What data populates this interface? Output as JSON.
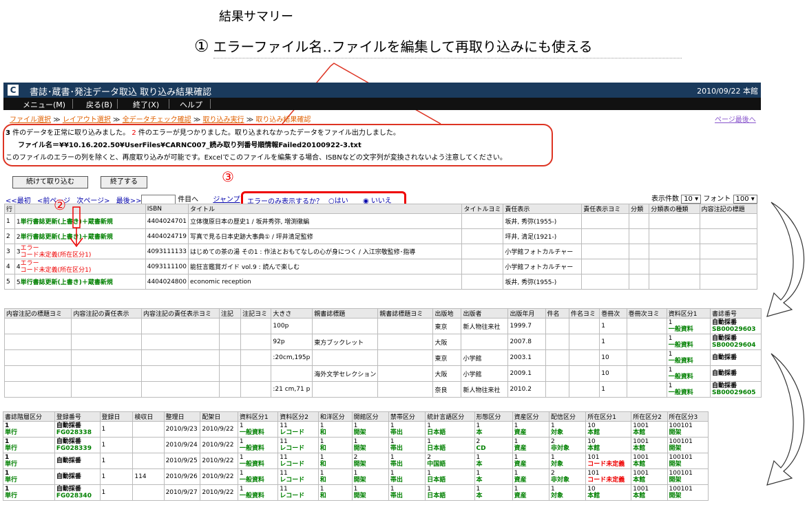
{
  "annotations": {
    "title": "結果サマリー",
    "num1": "①",
    "subtitle": "エラーファイル名‥ファイルを編集して再取り込みにも使える",
    "num2": "②",
    "num3": "③"
  },
  "window": {
    "title": "書誌･蔵書･発注データ取込 取り込み結果確認",
    "date": "2010/09/22 本館",
    "logo": "C"
  },
  "menu": [
    "メニュー(M)",
    "戻る(B)",
    "終了(X)",
    "ヘルプ"
  ],
  "breadcrumbs": [
    "ファイル選択",
    "レイアウト選択",
    "全データチェック確認",
    "取り込み実行",
    "取り込み結果確認"
  ],
  "breadcrumb_sep": "≫",
  "page_last": "ページ最後へ",
  "summary": {
    "ok_count": "3",
    "ok_text": "件のデータを正常に取り込みました。",
    "err_count": "2",
    "err_text": "件のエラーが見つかりました。取り込まれなかったデータをファイル出力しました。",
    "file_label": "ファイル名＝¥¥10.16.202.50¥UserFiles¥CARNC007_読み取り列番号順情報Failed20100922-3.txt",
    "note": "このファイルのエラーの列を除くと、再度取り込みが可能です。Excelでこのファイルを編集する場合、ISBNなどの文字列が変換されないよう注意してください。"
  },
  "buttons": {
    "continue": "続けて取り込む",
    "finish": "終了する"
  },
  "nav": {
    "first": "<<最初",
    "prev": "<前ページ",
    "next": "次ページ>",
    "last": "最後>>",
    "page_value": "",
    "page_suffix": "件目へ",
    "jump": "ジャンプ"
  },
  "filter": {
    "question": "エラーのみ表示するか？",
    "yes": "はい",
    "no": "いいえ",
    "selected": "no"
  },
  "display": {
    "count_label": "表示件数",
    "count_value": "10",
    "font_label": "フォント",
    "font_value": "100"
  },
  "table1": {
    "headers": [
      "行",
      "",
      "ISBN",
      "タイトル",
      "タイトルヨミ",
      "責任表示",
      "責任表示ヨミ",
      "分類",
      "分類表の種類",
      "内容注記の標題"
    ],
    "rows": [
      {
        "row": "1",
        "no": "1",
        "status": "単行書誌更新(上書き)＋蔵書新規",
        "status_type": "ok",
        "isbn": "4404024701",
        "title": "立体復原日本の歴史1 / 坂井秀弥, 増渕徹編",
        "resp": "坂井, 秀弥(1955-)"
      },
      {
        "row": "2",
        "no": "2",
        "status": "単行書誌更新(上書き)＋蔵書新規",
        "status_type": "ok",
        "isbn": "4404024719",
        "title": "写真で見る日本史跡大事典① / 坪井清足監修",
        "resp": "坪井, 清足(1921-)"
      },
      {
        "row": "3",
        "no": "3",
        "status": "エラー",
        "status2": "コード未定義(所在区分1)",
        "status_type": "err",
        "isbn": "4093111133",
        "title": "はじめての茶の湯 その1 : 作法とおもてなしの心が身につく / 入江宗敬監修･指導",
        "resp": "小学館フォトカルチャー"
      },
      {
        "row": "4",
        "no": "4",
        "status": "エラー",
        "status2": "コード未定義(所在区分1)",
        "status_type": "err",
        "isbn": "4093111100",
        "title": "能狂言鑑賞ガイド vol.9 : 読んで楽しむ",
        "resp": "小学館フォトカルチャー"
      },
      {
        "row": "5",
        "no": "5",
        "status": "単行書誌更新(上書き)＋蔵書新規",
        "status_type": "ok",
        "isbn": "4404024800",
        "title": "economic reception",
        "resp": "坂井, 秀弥(1955-)"
      }
    ]
  },
  "table2": {
    "headers": [
      "内容注記の標題ヨミ",
      "内容注記の責任表示",
      "内容注記の責任表示ヨミ",
      "注記",
      "注記ヨミ",
      "大きさ",
      "親書誌標題",
      "親書誌標題ヨミ",
      "出版地",
      "出版者",
      "出版年月",
      "件名",
      "件名ヨミ",
      "巻冊次",
      "巻冊次ヨミ",
      "資料区分1",
      "書誌番号"
    ],
    "rows": [
      {
        "size": "100p",
        "parent": "",
        "place": "東京",
        "pub": "新人物往来社",
        "date": "1999.7",
        "vol": "1",
        "type1a": "1",
        "type1b": "一般資料",
        "bib": "自動採番",
        "bib2": "SB00029603"
      },
      {
        "size": "92p",
        "parent": "東方ブックレット",
        "place": "大阪",
        "pub": "",
        "date": "2007.8",
        "vol": "1",
        "type1a": "1",
        "type1b": "一般資料",
        "bib": "自動採番",
        "bib2": "SB00029604"
      },
      {
        "size": ":20cm,195p",
        "parent": "",
        "place": "東京",
        "pub": "小学館",
        "date": "2003.1",
        "vol": "10",
        "type1a": "1",
        "type1b": "一般資料",
        "bib": "自動採番",
        "bib2": ""
      },
      {
        "size": "",
        "parent": "海外文学セレクション",
        "place": "大阪",
        "pub": "小学館",
        "date": "2009.1",
        "vol": "10",
        "type1a": "1",
        "type1b": "一般資料",
        "bib": "自動採番",
        "bib2": ""
      },
      {
        "size": ":21 cm,71 p",
        "parent": "",
        "place": "奈良",
        "pub": "新人物往来社",
        "date": "2010.2",
        "vol": "1",
        "type1a": "1",
        "type1b": "一般資料",
        "bib": "自動採番",
        "bib2": "SB00029605"
      }
    ]
  },
  "table3": {
    "headers": [
      "書誌階層区分",
      "登録番号",
      "登録日",
      "検収日",
      "整理日",
      "配架日",
      "資料区分1",
      "資料区分2",
      "和洋区分",
      "開館区分",
      "禁帯区分",
      "統計言語区分",
      "形態区分",
      "資産区分",
      "配信区分",
      "所在区分1",
      "所在区分2",
      "所在区分3"
    ],
    "rows": [
      {
        "lvl": [
          "1",
          "単行"
        ],
        "reg": [
          "自動採番",
          "FG028338"
        ],
        "rd": "1",
        "acc": "",
        "org": "2010/9/23",
        "shelf": "2010/9/22",
        "c1": [
          "1",
          "一般資料"
        ],
        "c2": [
          "11",
          "レコード"
        ],
        "wa": [
          "1",
          "和"
        ],
        "open": [
          "1",
          "開架"
        ],
        "ban": [
          "1",
          "帯出"
        ],
        "lang": [
          "1",
          "日本語"
        ],
        "form": [
          "1",
          "本"
        ],
        "asset": [
          "1",
          "資産"
        ],
        "dist": [
          "1",
          "対象"
        ],
        "loc1": [
          "10",
          "本館"
        ],
        "loc2": [
          "1001",
          "本館"
        ],
        "loc3": [
          "100101",
          "開架"
        ],
        "loc1err": false
      },
      {
        "lvl": [
          "1",
          "単行"
        ],
        "reg": [
          "自動採番",
          "FG028339"
        ],
        "rd": "1",
        "acc": "",
        "org": "2010/9/24",
        "shelf": "2010/9/22",
        "c1": [
          "1",
          "一般資料"
        ],
        "c2": [
          "11",
          "レコード"
        ],
        "wa": [
          "1",
          "和"
        ],
        "open": [
          "1",
          "開架"
        ],
        "ban": [
          "1",
          "帯出"
        ],
        "lang": [
          "1",
          "日本語"
        ],
        "form": [
          "2",
          "CD"
        ],
        "asset": [
          "1",
          "資産"
        ],
        "dist": [
          "2",
          "非対象"
        ],
        "loc1": [
          "10",
          "本館"
        ],
        "loc2": [
          "1001",
          "本館"
        ],
        "loc3": [
          "100101",
          "開架"
        ],
        "loc1err": false
      },
      {
        "lvl": [
          "1",
          "単行"
        ],
        "reg": [
          "自動採番",
          ""
        ],
        "rd": "1",
        "acc": "",
        "org": "2010/9/25",
        "shelf": "2010/9/22",
        "c1": [
          "1",
          "一般資料"
        ],
        "c2": [
          "11",
          "レコード"
        ],
        "wa": [
          "1",
          "和"
        ],
        "open": [
          "2",
          "開架"
        ],
        "ban": [
          "1",
          "帯出"
        ],
        "lang": [
          "2",
          "中国語"
        ],
        "form": [
          "1",
          "本"
        ],
        "asset": [
          "1",
          "資産"
        ],
        "dist": [
          "1",
          "対象"
        ],
        "loc1": [
          "101",
          "コード未定義"
        ],
        "loc2": [
          "1001",
          "本館"
        ],
        "loc3": [
          "100101",
          "開架"
        ],
        "loc1err": true
      },
      {
        "lvl": [
          "1",
          "単行"
        ],
        "reg": [
          "自動採番",
          ""
        ],
        "rd": "1",
        "acc": "114",
        "org": "2010/9/26",
        "shelf": "2010/9/22",
        "c1": [
          "1",
          "一般資料"
        ],
        "c2": [
          "11",
          "レコード"
        ],
        "wa": [
          "1",
          "和"
        ],
        "open": [
          "1",
          "開架"
        ],
        "ban": [
          "1",
          "帯出"
        ],
        "lang": [
          "1",
          "日本語"
        ],
        "form": [
          "1",
          "本"
        ],
        "asset": [
          "1",
          "資産"
        ],
        "dist": [
          "2",
          "非対象"
        ],
        "loc1": [
          "101",
          "コード未定義"
        ],
        "loc2": [
          "1001",
          "本館"
        ],
        "loc3": [
          "100101",
          "開架"
        ],
        "loc1err": true
      },
      {
        "lvl": [
          "1",
          "単行"
        ],
        "reg": [
          "自動採番",
          "FG028340"
        ],
        "rd": "1",
        "acc": "",
        "org": "2010/9/27",
        "shelf": "2010/9/22",
        "c1": [
          "1",
          "一般資料"
        ],
        "c2": [
          "11",
          "レコード"
        ],
        "wa": [
          "1",
          "和"
        ],
        "open": [
          "1",
          "開架"
        ],
        "ban": [
          "1",
          "帯出"
        ],
        "lang": [
          "1",
          "日本語"
        ],
        "form": [
          "1",
          "本"
        ],
        "asset": [
          "1",
          "資産"
        ],
        "dist": [
          "1",
          "対象"
        ],
        "loc1": [
          "10",
          "本館"
        ],
        "loc2": [
          "1001",
          "本館"
        ],
        "loc3": [
          "100101",
          "開架"
        ],
        "loc1err": false
      }
    ]
  }
}
